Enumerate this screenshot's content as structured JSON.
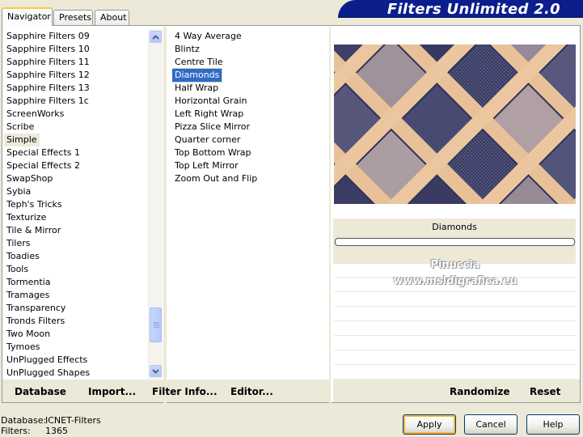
{
  "tabs": [
    {
      "label": "Navigator",
      "active": true
    },
    {
      "label": "Presets",
      "active": false
    },
    {
      "label": "About",
      "active": false
    }
  ],
  "title": "Filters Unlimited 2.0",
  "categories": {
    "items": [
      "Sapphire Filters 09",
      "Sapphire Filters 10",
      "Sapphire Filters 11",
      "Sapphire Filters 12",
      "Sapphire Filters 13",
      "Sapphire Filters 1c",
      "ScreenWorks",
      "Scribe",
      "Simple",
      "Special Effects 1",
      "Special Effects 2",
      "SwapShop",
      "Sybia",
      "Teph's Tricks",
      "Texturize",
      "Tile & Mirror",
      "Tilers",
      "Toadies",
      "Tools",
      "Tormentia",
      "Tramages",
      "Transparency",
      "Tronds Filters",
      "Two Moon",
      "Tymoes",
      "UnPlugged Effects",
      "UnPlugged Shapes"
    ],
    "selected": "Simple"
  },
  "filters": {
    "items": [
      "4 Way Average",
      "Blintz",
      "Centre Tile",
      "Diamonds",
      "Half Wrap",
      "Horizontal Grain",
      "Left Right Wrap",
      "Pizza Slice Mirror",
      "Quarter corner",
      "Top Bottom Wrap",
      "Top Left Mirror",
      "Zoom Out and Flip"
    ],
    "selected": "Diamonds"
  },
  "preview": {
    "caption": "Diamonds",
    "watermark_line1": "Pinuccia",
    "watermark_line2": "www.msldigrafica.eu"
  },
  "toolbar": {
    "database": "Database",
    "import": "Import...",
    "filter_info": "Filter Info...",
    "editor": "Editor...",
    "randomize": "Randomize",
    "reset": "Reset"
  },
  "status": {
    "database_label": "Database:",
    "database_value": "ICNET-Filters",
    "filters_label": "Filters:",
    "filters_value": "1365"
  },
  "buttons": {
    "apply": "Apply",
    "cancel": "Cancel",
    "help": "Help"
  },
  "colors": {
    "title_bar": "#0b1e8c",
    "selection": "#316ac5",
    "preview_peach": "#f3c99d",
    "preview_navy": "#2b2f55"
  }
}
